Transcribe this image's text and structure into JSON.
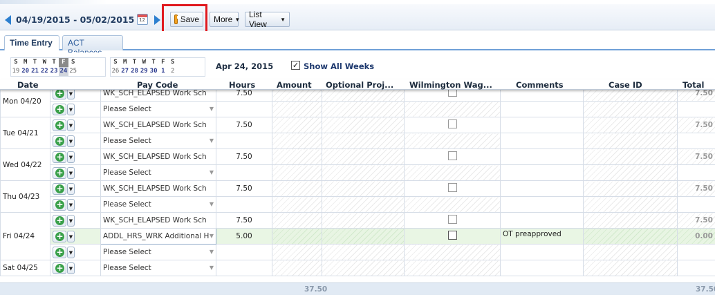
{
  "toolbar": {
    "date_range": "04/19/2015 - 05/02/2015",
    "save_label": "Save",
    "more_label": "More",
    "list_view_label": "List View",
    "calendar_icon_text": "12"
  },
  "tabs": [
    {
      "label": "Time Entry",
      "active": true
    },
    {
      "label": "ACT Balances",
      "active": false
    }
  ],
  "week": {
    "day_headers": [
      "S",
      "M",
      "T",
      "W",
      "T",
      "F",
      "S",
      "S",
      "M",
      "T",
      "W",
      "T",
      "F",
      "S"
    ],
    "days": [
      "19",
      "20",
      "21",
      "22",
      "23",
      "24",
      "25",
      "26",
      "27",
      "28",
      "29",
      "30",
      "1",
      "2"
    ],
    "selected_index": 5,
    "selected_date": "Apr 24, 2015",
    "show_all_weeks_label": "Show All Weeks",
    "show_all_weeks_checked": true
  },
  "columns": [
    "Date",
    "Pay Code",
    "Hours",
    "Amount",
    "Optional Proj...",
    "Wilmington Wag...",
    "Comments",
    "Case ID",
    "Total"
  ],
  "rows": [
    {
      "date": "Mon 04/20",
      "entries": [
        {
          "pay_code": "WK_SCH_ELAPSED Work Sch",
          "hours": "7.50",
          "total": "7.50",
          "comment": ""
        },
        {
          "pay_code": "Please Select",
          "hours": "",
          "total": "",
          "comment": ""
        }
      ]
    },
    {
      "date": "Tue 04/21",
      "entries": [
        {
          "pay_code": "WK_SCH_ELAPSED Work Sch",
          "hours": "7.50",
          "total": "7.50",
          "comment": ""
        },
        {
          "pay_code": "Please Select",
          "hours": "",
          "total": "",
          "comment": ""
        }
      ]
    },
    {
      "date": "Wed 04/22",
      "entries": [
        {
          "pay_code": "WK_SCH_ELAPSED Work Sch",
          "hours": "7.50",
          "total": "7.50",
          "comment": ""
        },
        {
          "pay_code": "Please Select",
          "hours": "",
          "total": "",
          "comment": ""
        }
      ]
    },
    {
      "date": "Thu 04/23",
      "entries": [
        {
          "pay_code": "WK_SCH_ELAPSED Work Sch",
          "hours": "7.50",
          "total": "7.50",
          "comment": ""
        },
        {
          "pay_code": "Please Select",
          "hours": "",
          "total": "",
          "comment": ""
        }
      ]
    },
    {
      "date": "Fri 04/24",
      "entries": [
        {
          "pay_code": "WK_SCH_ELAPSED Work Sch",
          "hours": "7.50",
          "total": "7.50",
          "comment": ""
        },
        {
          "pay_code": "ADDL_HRS_WRK Additional H",
          "hours": "5.00",
          "total": "0.00",
          "comment": "OT preapproved"
        },
        {
          "pay_code": "Please Select",
          "hours": "",
          "total": "",
          "comment": ""
        }
      ]
    },
    {
      "date": "Sat 04/25",
      "entries": [
        {
          "pay_code": "Please Select",
          "hours": "",
          "total": "",
          "comment": ""
        }
      ]
    }
  ],
  "footer": {
    "hours_total": "37.50",
    "grand_total": "37.50"
  },
  "colors": {
    "accent": "#2c7fcf",
    "highlight": "#e0191e",
    "selected_row": "#e9f6e4"
  }
}
